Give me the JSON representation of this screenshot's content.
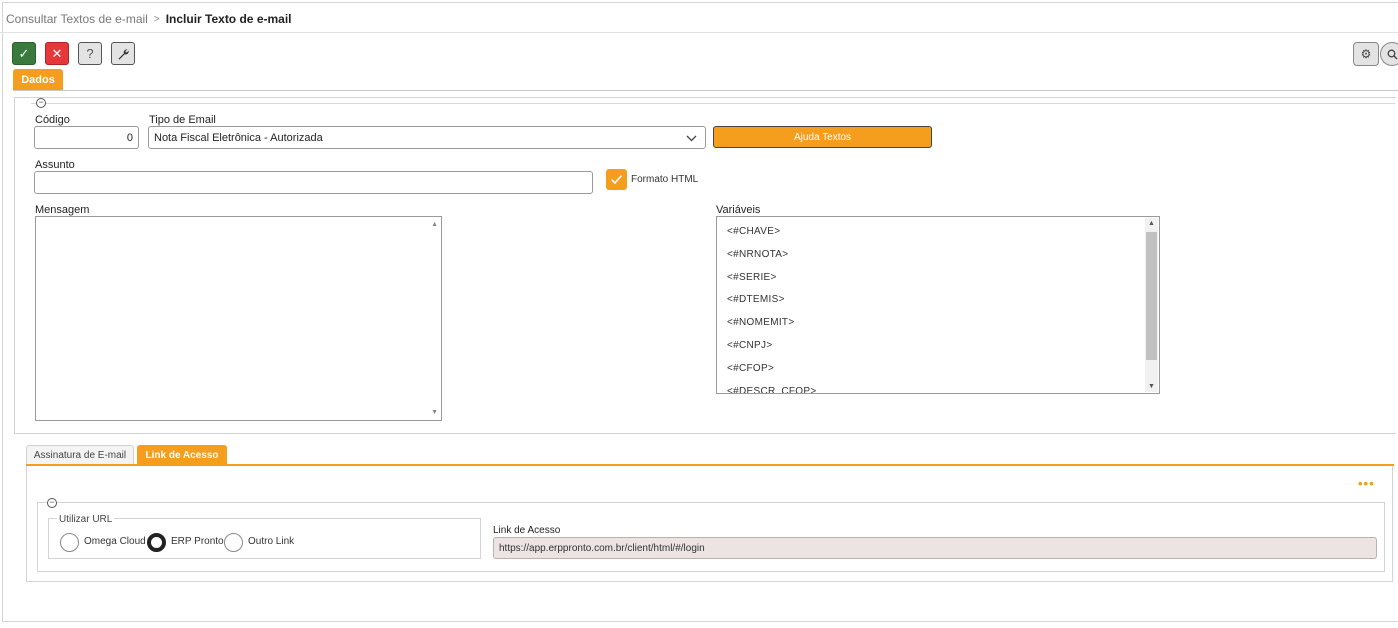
{
  "breadcrumb": {
    "parent": "Consultar Textos de e-mail",
    "separator": ">",
    "current": "Incluir Texto de e-mail"
  },
  "toolbar": {
    "ok": "✓",
    "cancel": "✕",
    "help": "?",
    "tools": "🔧",
    "settings": "⚙",
    "search": "🔍"
  },
  "tabs": {
    "main": "Dados"
  },
  "form": {
    "codigo_label": "Código",
    "codigo_value": "0",
    "tipo_label": "Tipo de Email",
    "tipo_value": "Nota Fiscal Eletrônica - Autorizada",
    "ajuda_button": "Ajuda Textos",
    "assunto_label": "Assunto",
    "assunto_value": "",
    "formato_html_label": "Formato HTML",
    "formato_html_checked": true,
    "mensagem_label": "Mensagem",
    "variaveis_label": "Variáveis",
    "variaveis": [
      "<#CHAVE>",
      "<#NRNOTA>",
      "<#SERIE>",
      "<#DTEMIS>",
      "<#NOMEMIT>",
      "<#CNPJ>",
      "<#CFOP>",
      "<#DESCR_CFOP>"
    ]
  },
  "subtabs": {
    "assinatura": "Assinatura de E-mail",
    "link": "Link de Acesso"
  },
  "link_section": {
    "more": "•••",
    "group_title": "Utilizar URL",
    "options": [
      "Omega Cloud",
      "ERP Pronto",
      "Outro Link"
    ],
    "selected": "ERP Pronto",
    "link_label": "Link de Acesso",
    "link_value": "https://app.erppronto.com.br/client/html/#/login"
  },
  "colors": {
    "accent": "#f59d1c",
    "ok": "#3a7a3c",
    "cancel": "#e6383b"
  }
}
